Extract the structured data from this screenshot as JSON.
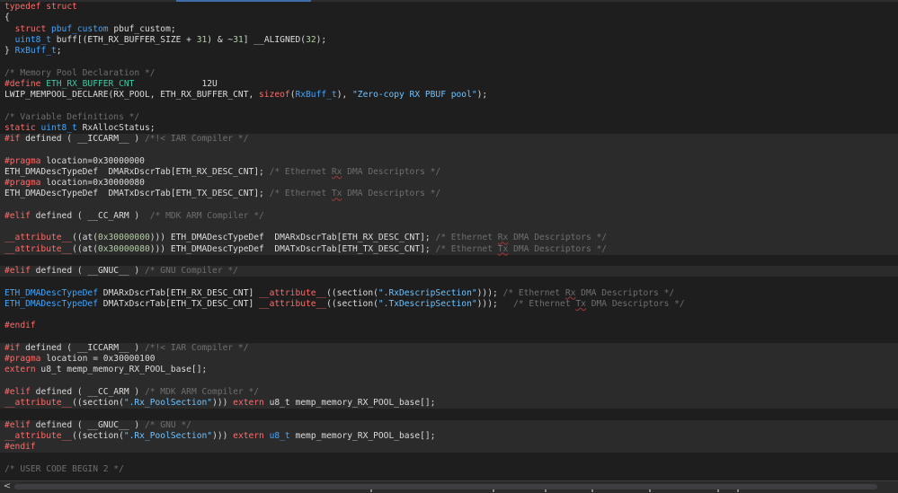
{
  "editor": {
    "language": "C",
    "colors": {
      "background": "#1e1e1e",
      "inactive_region": "#2b2b2b",
      "keyword": "#ff6a6a",
      "type": "#3fa5ff",
      "number": "#b5cea8",
      "string": "#6cc2ff",
      "comment": "#6e6e6e",
      "macro": "#3ec6a4",
      "plain": "#dcdcdc"
    },
    "lines": [
      {
        "inactive": false,
        "tokens": [
          {
            "t": "kw",
            "v": "typedef"
          },
          {
            "t": "pl",
            "v": " "
          },
          {
            "t": "kw",
            "v": "struct"
          }
        ]
      },
      {
        "inactive": false,
        "tokens": [
          {
            "t": "pl",
            "v": "{"
          }
        ]
      },
      {
        "inactive": false,
        "tokens": [
          {
            "t": "pl",
            "v": "  "
          },
          {
            "t": "kw",
            "v": "struct"
          },
          {
            "t": "pl",
            "v": " "
          },
          {
            "t": "ty",
            "v": "pbuf_custom"
          },
          {
            "t": "pl",
            "v": " pbuf_custom;"
          }
        ]
      },
      {
        "inactive": false,
        "tokens": [
          {
            "t": "pl",
            "v": "  "
          },
          {
            "t": "ty",
            "v": "uint8_t"
          },
          {
            "t": "pl",
            "v": " buff[(ETH_RX_BUFFER_SIZE + "
          },
          {
            "t": "num",
            "v": "31"
          },
          {
            "t": "pl",
            "v": ") & ~"
          },
          {
            "t": "num",
            "v": "31"
          },
          {
            "t": "pl",
            "v": "] __ALIGNED("
          },
          {
            "t": "num",
            "v": "32"
          },
          {
            "t": "pl",
            "v": ");"
          }
        ]
      },
      {
        "inactive": false,
        "tokens": [
          {
            "t": "pl",
            "v": "} "
          },
          {
            "t": "ty",
            "v": "RxBuff_t"
          },
          {
            "t": "pl",
            "v": ";"
          }
        ]
      },
      {
        "inactive": false,
        "tokens": [
          {
            "t": "pl",
            "v": ""
          }
        ]
      },
      {
        "inactive": false,
        "tokens": [
          {
            "t": "cm",
            "v": "/* Memory Pool Declaration */"
          }
        ]
      },
      {
        "inactive": false,
        "tokens": [
          {
            "t": "pp",
            "v": "#define"
          },
          {
            "t": "pl",
            "v": " "
          },
          {
            "t": "mac",
            "v": "ETH_RX_BUFFER_CNT"
          },
          {
            "t": "pl",
            "v": "             12U"
          }
        ]
      },
      {
        "inactive": false,
        "tokens": [
          {
            "t": "pl",
            "v": "LWIP_MEMPOOL_DECLARE(RX_POOL, ETH_RX_BUFFER_CNT, "
          },
          {
            "t": "kw",
            "v": "sizeof"
          },
          {
            "t": "pl",
            "v": "("
          },
          {
            "t": "ty",
            "v": "RxBuff_t"
          },
          {
            "t": "pl",
            "v": "), "
          },
          {
            "t": "str",
            "v": "\"Zero-copy RX PBUF pool\""
          },
          {
            "t": "pl",
            "v": ");"
          }
        ]
      },
      {
        "inactive": false,
        "tokens": [
          {
            "t": "pl",
            "v": ""
          }
        ]
      },
      {
        "inactive": false,
        "tokens": [
          {
            "t": "cm",
            "v": "/* Variable Definitions */"
          }
        ]
      },
      {
        "inactive": false,
        "tokens": [
          {
            "t": "kw",
            "v": "static"
          },
          {
            "t": "pl",
            "v": " "
          },
          {
            "t": "ty",
            "v": "uint8_t"
          },
          {
            "t": "pl",
            "v": " RxAllocStatus;"
          }
        ]
      },
      {
        "inactive": true,
        "tokens": [
          {
            "t": "pp",
            "v": "#if"
          },
          {
            "t": "pl",
            "v": " defined ( __ICCARM__ ) "
          },
          {
            "t": "cm",
            "v": "/*!< IAR Compiler */"
          }
        ]
      },
      {
        "inactive": true,
        "tokens": [
          {
            "t": "pl",
            "v": ""
          }
        ]
      },
      {
        "inactive": true,
        "tokens": [
          {
            "t": "pp",
            "v": "#pragma"
          },
          {
            "t": "pl",
            "v": " location=0x30000000"
          }
        ]
      },
      {
        "inactive": true,
        "tokens": [
          {
            "t": "pl",
            "v": "ETH_DMADescTypeDef  DMARxDscrTab[ETH_RX_DESC_CNT]; "
          },
          {
            "t": "cm",
            "v": "/* Ethernet "
          },
          {
            "t": "spell",
            "v": "Rx"
          },
          {
            "t": "cm",
            "v": " DMA Descriptors */"
          }
        ]
      },
      {
        "inactive": true,
        "tokens": [
          {
            "t": "pp",
            "v": "#pragma"
          },
          {
            "t": "pl",
            "v": " location=0x30000080"
          }
        ]
      },
      {
        "inactive": true,
        "tokens": [
          {
            "t": "pl",
            "v": "ETH_DMADescTypeDef  DMATxDscrTab[ETH_TX_DESC_CNT]; "
          },
          {
            "t": "cm",
            "v": "/* Ethernet "
          },
          {
            "t": "spell",
            "v": "Tx"
          },
          {
            "t": "cm",
            "v": " DMA Descriptors */"
          }
        ]
      },
      {
        "inactive": true,
        "tokens": [
          {
            "t": "pl",
            "v": ""
          }
        ]
      },
      {
        "inactive": true,
        "tokens": [
          {
            "t": "pp",
            "v": "#elif"
          },
          {
            "t": "pl",
            "v": " defined ( __CC_ARM )  "
          },
          {
            "t": "cm",
            "v": "/* MDK ARM Compiler */"
          }
        ]
      },
      {
        "inactive": true,
        "tokens": [
          {
            "t": "pl",
            "v": ""
          }
        ]
      },
      {
        "inactive": true,
        "tokens": [
          {
            "t": "kw",
            "v": "__attribute__"
          },
          {
            "t": "pl",
            "v": "((at("
          },
          {
            "t": "num",
            "v": "0x30000000"
          },
          {
            "t": "pl",
            "v": "))) ETH_DMADescTypeDef  DMARxDscrTab[ETH_RX_DESC_CNT]; "
          },
          {
            "t": "cm",
            "v": "/* Ethernet "
          },
          {
            "t": "spell",
            "v": "Rx"
          },
          {
            "t": "cm",
            "v": " DMA Descriptors */"
          }
        ]
      },
      {
        "inactive": true,
        "tokens": [
          {
            "t": "kw",
            "v": "__attribute__"
          },
          {
            "t": "pl",
            "v": "((at("
          },
          {
            "t": "num",
            "v": "0x30000080"
          },
          {
            "t": "pl",
            "v": "))) ETH_DMADescTypeDef  DMATxDscrTab[ETH_TX_DESC_CNT]; "
          },
          {
            "t": "cm",
            "v": "/* Ethernet "
          },
          {
            "t": "spell",
            "v": "Tx"
          },
          {
            "t": "cm",
            "v": " DMA Descriptors */"
          }
        ]
      },
      {
        "inactive": false,
        "tokens": [
          {
            "t": "pl",
            "v": ""
          }
        ]
      },
      {
        "inactive": true,
        "tokens": [
          {
            "t": "pp",
            "v": "#elif"
          },
          {
            "t": "pl",
            "v": " defined ( __GNUC__ ) "
          },
          {
            "t": "cm",
            "v": "/* GNU Compiler */"
          }
        ]
      },
      {
        "inactive": false,
        "tokens": [
          {
            "t": "pl",
            "v": ""
          }
        ]
      },
      {
        "inactive": false,
        "tokens": [
          {
            "t": "ty",
            "v": "ETH_DMADescTypeDef"
          },
          {
            "t": "pl",
            "v": " DMARxDscrTab[ETH_RX_DESC_CNT] "
          },
          {
            "t": "kw",
            "v": "__attribute__"
          },
          {
            "t": "pl",
            "v": "((section("
          },
          {
            "t": "str",
            "v": "\".RxDescripSection\""
          },
          {
            "t": "pl",
            "v": "))); "
          },
          {
            "t": "cm",
            "v": "/* Ethernet "
          },
          {
            "t": "spell",
            "v": "Rx"
          },
          {
            "t": "cm",
            "v": " DMA Descriptors */"
          }
        ]
      },
      {
        "inactive": false,
        "tokens": [
          {
            "t": "ty",
            "v": "ETH_DMADescTypeDef"
          },
          {
            "t": "pl",
            "v": " DMATxDscrTab[ETH_TX_DESC_CNT] "
          },
          {
            "t": "kw",
            "v": "__attribute__"
          },
          {
            "t": "pl",
            "v": "((section("
          },
          {
            "t": "str",
            "v": "\".TxDescripSection\""
          },
          {
            "t": "pl",
            "v": ")));   "
          },
          {
            "t": "cm",
            "v": "/* Ethernet "
          },
          {
            "t": "spell",
            "v": "Tx"
          },
          {
            "t": "cm",
            "v": " DMA Descriptors */"
          }
        ]
      },
      {
        "inactive": false,
        "tokens": [
          {
            "t": "pl",
            "v": ""
          }
        ]
      },
      {
        "inactive": false,
        "tokens": [
          {
            "t": "pp",
            "v": "#endif"
          }
        ]
      },
      {
        "inactive": false,
        "tokens": [
          {
            "t": "pl",
            "v": ""
          }
        ]
      },
      {
        "inactive": true,
        "tokens": [
          {
            "t": "pp",
            "v": "#if"
          },
          {
            "t": "pl",
            "v": " defined ( __ICCARM__ ) "
          },
          {
            "t": "cm",
            "v": "/*!< IAR Compiler */"
          }
        ]
      },
      {
        "inactive": true,
        "tokens": [
          {
            "t": "pp",
            "v": "#pragma"
          },
          {
            "t": "pl",
            "v": " location = 0x30000100"
          }
        ]
      },
      {
        "inactive": true,
        "tokens": [
          {
            "t": "kw",
            "v": "extern"
          },
          {
            "t": "pl",
            "v": " u8_t memp_memory_RX_POOL_base[];"
          }
        ]
      },
      {
        "inactive": true,
        "tokens": [
          {
            "t": "pl",
            "v": ""
          }
        ]
      },
      {
        "inactive": true,
        "tokens": [
          {
            "t": "pp",
            "v": "#elif"
          },
          {
            "t": "pl",
            "v": " defined ( __CC_ARM ) "
          },
          {
            "t": "cm",
            "v": "/* MDK ARM Compiler */"
          }
        ]
      },
      {
        "inactive": true,
        "tokens": [
          {
            "t": "kw",
            "v": "__attribute__"
          },
          {
            "t": "pl",
            "v": "((section("
          },
          {
            "t": "str",
            "v": "\".Rx_PoolSection\""
          },
          {
            "t": "pl",
            "v": "))) "
          },
          {
            "t": "kw",
            "v": "extern"
          },
          {
            "t": "pl",
            "v": " u8_t memp_memory_RX_POOL_base[];"
          }
        ]
      },
      {
        "inactive": false,
        "tokens": [
          {
            "t": "pl",
            "v": ""
          }
        ]
      },
      {
        "inactive": true,
        "tokens": [
          {
            "t": "pp",
            "v": "#elif"
          },
          {
            "t": "pl",
            "v": " defined ( __GNUC__ ) "
          },
          {
            "t": "cm",
            "v": "/* GNU */"
          }
        ]
      },
      {
        "inactive": true,
        "tokens": [
          {
            "t": "kw",
            "v": "__attribute__"
          },
          {
            "t": "pl",
            "v": "((section("
          },
          {
            "t": "str",
            "v": "\".Rx_PoolSection\""
          },
          {
            "t": "pl",
            "v": "))) "
          },
          {
            "t": "kw",
            "v": "extern"
          },
          {
            "t": "pl",
            "v": " "
          },
          {
            "t": "ty",
            "v": "u8_t"
          },
          {
            "t": "pl",
            "v": " memp_memory_RX_POOL_base[];"
          }
        ]
      },
      {
        "inactive": true,
        "tokens": [
          {
            "t": "pp",
            "v": "#endif"
          }
        ]
      },
      {
        "inactive": false,
        "tokens": [
          {
            "t": "pl",
            "v": ""
          }
        ]
      },
      {
        "inactive": false,
        "tokens": [
          {
            "t": "cm",
            "v": "/* USER CODE BEGIN 2 */"
          }
        ]
      }
    ]
  },
  "hscrollbar": {
    "left_arrow": "<",
    "marker_color": "#8a8a8a"
  }
}
